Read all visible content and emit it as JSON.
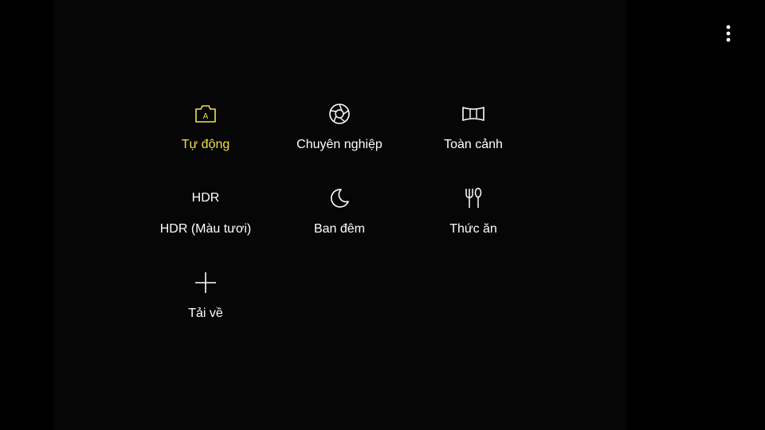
{
  "colors": {
    "accent": "#f0e24a",
    "text": "#ffffff",
    "background": "#000000"
  },
  "toolbar": {
    "more_icon": "more-vertical-icon"
  },
  "modes": [
    {
      "label": "Tự động",
      "icon": "camera-auto-icon",
      "selected": true
    },
    {
      "label": "Chuyên nghiệp",
      "icon": "aperture-icon",
      "selected": false
    },
    {
      "label": "Toàn cảnh",
      "icon": "panorama-icon",
      "selected": false
    },
    {
      "label": "HDR (Màu tươi)",
      "icon": "hdr-icon",
      "icon_text": "HDR",
      "selected": false
    },
    {
      "label": "Ban đêm",
      "icon": "moon-icon",
      "selected": false
    },
    {
      "label": "Thức ăn",
      "icon": "fork-spoon-icon",
      "selected": false
    },
    {
      "label": "Tải về",
      "icon": "plus-icon",
      "selected": false
    }
  ]
}
